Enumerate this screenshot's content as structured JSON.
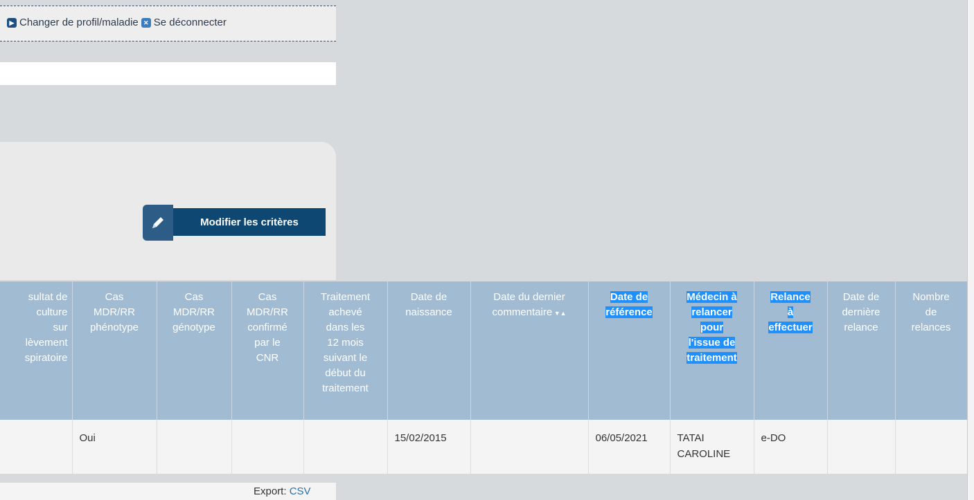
{
  "topbar": {
    "change_profile": "Changer de profil/maladie",
    "logout": "Se déconnecter"
  },
  "criteria": {
    "modify_label": "Modifier les critères"
  },
  "table": {
    "headers": [
      [
        "sultat de",
        "culture",
        "sur",
        "lèvement",
        "spiratoire"
      ],
      [
        "Cas",
        "MDR/RR",
        "phénotype"
      ],
      [
        "Cas",
        "MDR/RR",
        "génotype"
      ],
      [
        "Cas",
        "MDR/RR",
        "confirmé",
        "par le",
        "CNR"
      ],
      [
        "Traitement",
        "achevé",
        "dans les",
        "12 mois",
        "suivant le",
        "début du",
        "traitement"
      ],
      [
        "Date de",
        "naissance"
      ],
      [
        "Date du dernier",
        "commentaire"
      ],
      [
        "Date de",
        "référence"
      ],
      [
        "Médecin à",
        "relancer",
        "pour",
        "l'issue de",
        "traitement"
      ],
      [
        "Relance",
        "à",
        "effectuer"
      ],
      [
        "Date de",
        "dernière",
        "relance"
      ],
      [
        "Nombre",
        "de",
        "relances"
      ]
    ],
    "rows": [
      [
        "",
        "Oui",
        "",
        "",
        "",
        "15/02/2015",
        "",
        "06/05/2021",
        "TATAI CAROLINE",
        "e-DO",
        "",
        ""
      ]
    ]
  },
  "export": {
    "label": "Export:",
    "csv": "CSV"
  },
  "colors": {
    "header_bg": "#a1bbd2",
    "highlight": "#1e90ff",
    "button": "#0e4772"
  }
}
